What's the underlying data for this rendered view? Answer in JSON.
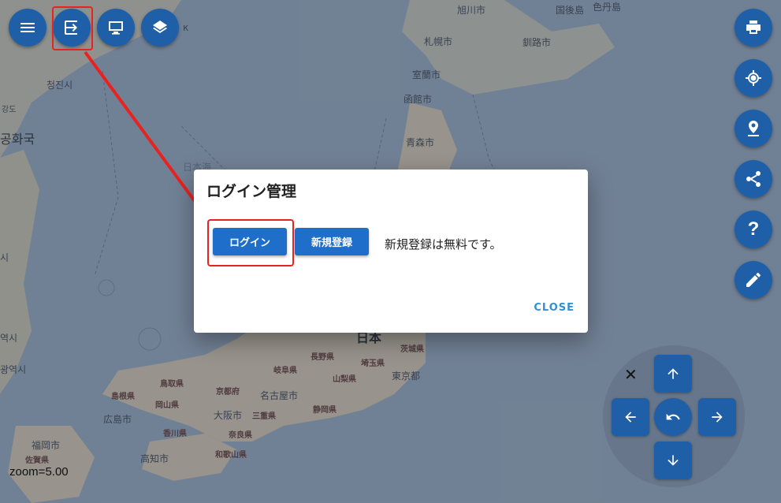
{
  "map": {
    "labels": {
      "asahikawa": "旭川市",
      "kunashiri": "国後島",
      "shikotan": "色丹島",
      "sapporo": "札幌市",
      "kushiro": "釧路市",
      "muroran": "室蘭市",
      "hakodate": "函館市",
      "aomori": "青森市",
      "chongjin": "청진시",
      "korea": "공화국",
      "nihonkai": "日本海",
      "nagano": "長野県",
      "saitama": "埼玉県",
      "ibaraki": "茨城県",
      "gifu": "岐阜県",
      "yamanashi": "山梨県",
      "tokyo": "東京都",
      "tottori": "鳥取県",
      "shimane": "島根県",
      "okayama": "岡山県",
      "kyotofu": "京都府",
      "nagoya": "名古屋市",
      "shizuoka": "静岡県",
      "hiroshima": "広島市",
      "osaka": "大阪市",
      "mie": "三重県",
      "kagawa": "香川県",
      "nara": "奈良県",
      "fukuoka": "福岡市",
      "kochi": "高知市",
      "saga": "佐賀県",
      "wakayama": "和歌山県",
      "nihon": "日本",
      "gangdo": "강도",
      "yeoksi1": "역시",
      "yeoksi2": "광역시",
      "si": "시",
      "vostok": "к"
    },
    "zoom_text": "zoom=5.00"
  },
  "toolbar_left": [
    {
      "icon": "menu-icon"
    },
    {
      "icon": "login-icon"
    },
    {
      "icon": "monitor-icon"
    },
    {
      "icon": "layers-icon"
    }
  ],
  "toolbar_right": [
    {
      "icon": "print-icon"
    },
    {
      "icon": "location-icon"
    },
    {
      "icon": "place-icon"
    },
    {
      "icon": "share-icon"
    },
    {
      "icon": "help-icon"
    },
    {
      "icon": "edit-icon"
    }
  ],
  "dialog": {
    "title": "ログイン管理",
    "login_label": "ログイン",
    "register_label": "新規登録",
    "note": "新規登録は無料です。",
    "close_label": "CLOSE"
  },
  "nav": {
    "close_glyph": "✕"
  },
  "colors": {
    "accent": "#1f5fa8",
    "button": "#1f6ec9",
    "annotation": "#e8231f",
    "close_text": "#3590d0"
  }
}
